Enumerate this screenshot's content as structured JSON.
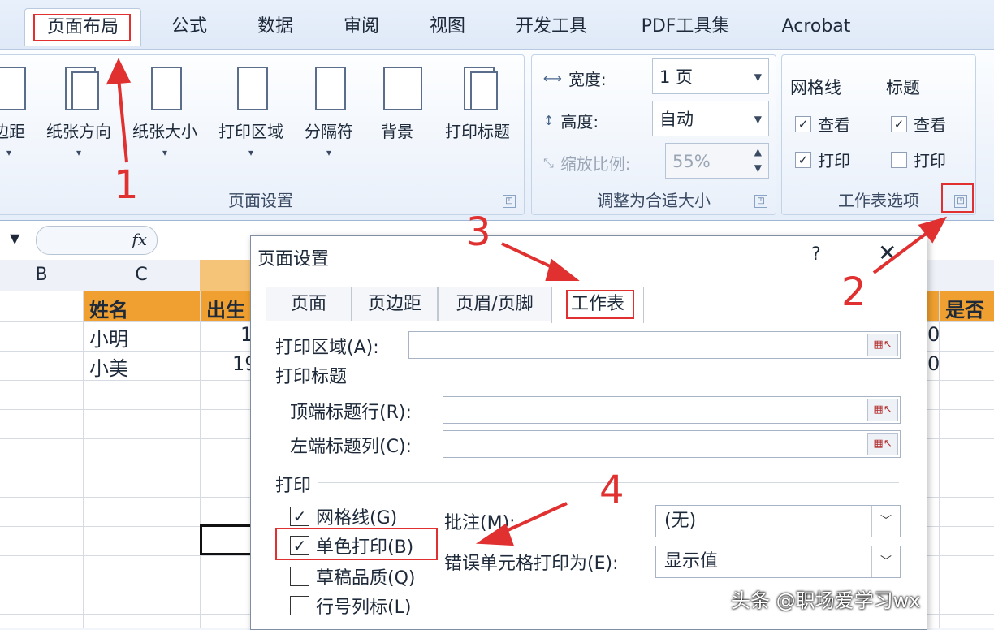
{
  "tabs": [
    "页面布局",
    "公式",
    "数据",
    "审阅",
    "视图",
    "开发工具",
    "PDF工具集",
    "Acrobat"
  ],
  "ribbon": {
    "page_setup": {
      "label": "页面设置",
      "buttons": [
        "边距",
        "纸张方向",
        "纸张大小",
        "打印区域",
        "分隔符",
        "背景",
        "打印标题"
      ]
    },
    "scale_to_fit": {
      "label": "调整为合适大小",
      "width_label": "宽度:",
      "width_value": "1 页",
      "height_label": "高度:",
      "height_value": "自动",
      "scale_label": "缩放比例:",
      "scale_value": "55%"
    },
    "sheet_options": {
      "label": "工作表选项",
      "gridlines_label": "网格线",
      "headings_label": "标题",
      "view": "查看",
      "print": "打印",
      "gridlines_view": true,
      "gridlines_print": true,
      "headings_view": true,
      "headings_print": false
    }
  },
  "formula_bar": {
    "fx": "fx"
  },
  "sheet": {
    "columns": [
      "B",
      "C"
    ],
    "header_row": [
      "姓名",
      "出生",
      "是否"
    ],
    "rows": [
      [
        "小明",
        "1"
      ],
      [
        "小美",
        "19"
      ]
    ],
    "partial_right": [
      "0",
      "0"
    ]
  },
  "dialog": {
    "title": "页面设置",
    "help": "?",
    "close": "✕",
    "tabs": [
      "页面",
      "页边距",
      "页眉/页脚",
      "工作表"
    ],
    "print_area_label": "打印区域(A):",
    "print_titles_label": "打印标题",
    "top_rows_label": "顶端标题行(R):",
    "left_cols_label": "左端标题列(C):",
    "print_label": "打印",
    "gridlines": "网格线(G)",
    "bw": "单色打印(B)",
    "draft": "草稿品质(Q)",
    "row_col_headings": "行号列标(L)",
    "comments_label": "批注(M):",
    "comments_value": "(无)",
    "errors_label": "错误单元格打印为(E):",
    "errors_value": "显示值",
    "gridlines_checked": true,
    "bw_checked": true,
    "draft_checked": false,
    "row_col_checked": false
  },
  "annotations": [
    "1",
    "2",
    "3",
    "4"
  ],
  "watermark": "头条 @职场爱学习wx",
  "colors": {
    "accent_red": "#e03030",
    "header_orange": "#f0a030"
  }
}
